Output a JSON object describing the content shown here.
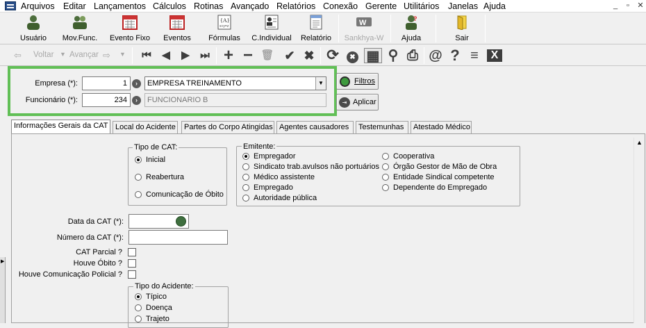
{
  "menu": {
    "items": [
      "Arquivos",
      "Editar",
      "Lançamentos",
      "Cálculos",
      "Rotinas",
      "Avançado",
      "Relatórios",
      "Conexão",
      "Gerente",
      "Utilitários",
      "Janelas",
      "Ajuda"
    ],
    "window_controls": {
      "minimize": "_",
      "restore": "▫",
      "close": "✕"
    }
  },
  "toolbar": {
    "buttons": [
      {
        "label": "Usuário",
        "icon": "user-icon"
      },
      {
        "label": "Mov.Func.",
        "icon": "users-icon"
      },
      {
        "label": "Evento Fixo",
        "icon": "calendar-icon"
      },
      {
        "label": "Eventos",
        "icon": "calendar-icon"
      },
      {
        "label": "Fórmulas",
        "icon": "formula-icon"
      },
      {
        "label": "C.Individual",
        "icon": "id-card-icon"
      },
      {
        "label": "Relatório",
        "icon": "report-icon"
      },
      {
        "label": "Sankhya-W",
        "icon": "sankhya-icon"
      },
      {
        "label": "Ajuda",
        "icon": "help-icon"
      },
      {
        "label": "Sair",
        "icon": "exit-icon"
      }
    ]
  },
  "nav": {
    "voltar": "Voltar",
    "avancar": "Avançar",
    "glyphs": {
      "first": "⏮",
      "prev": "◀",
      "next": "▶",
      "last": "⏭",
      "add": "+",
      "remove": "−",
      "trash": "🗑",
      "confirm": "✔",
      "cancel": "✖",
      "refresh": "⟳",
      "stop": "✖",
      "grid": "▦",
      "search": "⚲",
      "print": "⎙",
      "email": "@",
      "help": "?",
      "filter": "≡",
      "excel": "X"
    }
  },
  "form": {
    "empresa_label": "Empresa (*):",
    "empresa_code": "1",
    "empresa_name": "EMPRESA TREINAMENTO",
    "funcionario_label": "Funcionário (*):",
    "funcionario_code": "234",
    "funcionario_name": "FUNCIONARIO B",
    "filtros": "Filtros",
    "aplicar": "Aplicar"
  },
  "tabs": [
    "Informações Gerais da CAT",
    "Local do Acidente",
    "Partes do Corpo Atingidas",
    "Agentes causadores",
    "Testemunhas",
    "Atestado Médico"
  ],
  "tipo_cat": {
    "title": "Tipo de CAT:",
    "options": [
      "Inicial",
      "Reabertura",
      "Comunicação de Óbito"
    ],
    "selected": 0
  },
  "emitente": {
    "title": "Emitente:",
    "col1": [
      "Empregador",
      "Sindicato trab.avulsos não portuários",
      "Médico assistente",
      "Empregado",
      "Autoridade pública"
    ],
    "col2": [
      "Cooperativa",
      "Órgão Gestor de Mão de Obra",
      "Entidade Sindical competente",
      "Dependente do Empregado"
    ],
    "selected": "Empregador"
  },
  "fields": {
    "data_cat": "Data da CAT (*):",
    "numero_cat": "Número da CAT (*):",
    "cat_parcial": "CAT Parcial ?",
    "houve_obito": "Houve Óbito ?",
    "houve_comunicacao": "Houve Comunicação Policial ?"
  },
  "tipo_acidente": {
    "title": "Tipo do Acidente:",
    "options": [
      "Típico",
      "Doença",
      "Trajeto"
    ],
    "selected": 0
  },
  "colors": {
    "highlight": "#61bf56",
    "accent": "#2a4f8a"
  }
}
